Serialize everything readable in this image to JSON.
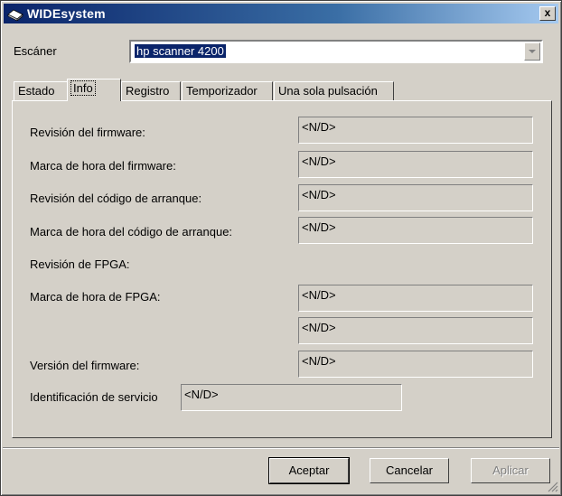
{
  "window": {
    "title": "WIDEsystem",
    "close_label": "x"
  },
  "scanner": {
    "label": "Escáner",
    "value": "hp scanner 4200"
  },
  "tabs": [
    {
      "label": "Estado"
    },
    {
      "label": "Info",
      "active": true
    },
    {
      "label": "Registro"
    },
    {
      "label": "Temporizador"
    },
    {
      "label": "Una sola pulsación"
    }
  ],
  "info": {
    "firmware_revision_label": "Revisión del firmware:",
    "firmware_revision_value": "<N/D>",
    "firmware_timestamp_label": "Marca de hora del firmware:",
    "firmware_timestamp_value": "<N/D>",
    "boot_code_revision_label": "Revisión del código de arranque:",
    "boot_code_revision_value": "<N/D>",
    "boot_code_timestamp_label": "Marca de hora del código de arranque:",
    "boot_code_timestamp_value": "<N/D>",
    "fpga_revision_label": "Revisión de FPGA:",
    "fpga_timestamp_label": "Marca de hora de FPGA:",
    "fpga_timestamp_value": "<N/D>",
    "fpga_extra_value": "<N/D>",
    "firmware_version_label": "Versión del firmware:",
    "firmware_version_value": "<N/D>",
    "service_id_label": "Identificación de servicio",
    "service_id_value": "<N/D>"
  },
  "buttons": {
    "accept": "Aceptar",
    "cancel": "Cancelar",
    "apply": "Aplicar"
  }
}
